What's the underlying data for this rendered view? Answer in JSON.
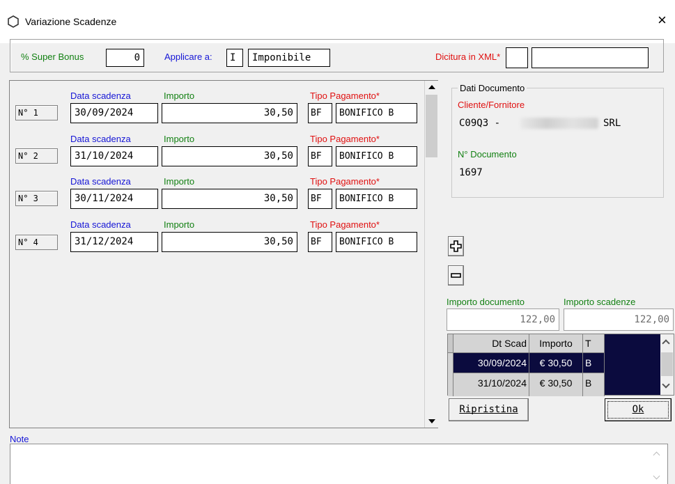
{
  "window": {
    "title": "Variazione Scadenze",
    "close": "×"
  },
  "top": {
    "super_bonus_label": "% Super Bonus",
    "super_bonus_value": "0",
    "applicare_label": "Applicare a:",
    "applicare_code": "I",
    "applicare_desc": "Imponibile",
    "dicitura_label": "Dicitura in XML*",
    "dicitura_code": "",
    "dicitura_desc": ""
  },
  "rows": [
    {
      "num": "N° 1",
      "date_label": "Data scadenza",
      "date": "30/09/2024",
      "amount_label": "Importo",
      "amount": "30,50",
      "pay_label": "Tipo Pagamento*",
      "pay_code": "BF",
      "pay_desc": "BONIFICO B"
    },
    {
      "num": "N° 2",
      "date_label": "Data scadenza",
      "date": "31/10/2024",
      "amount_label": "Importo",
      "amount": "30,50",
      "pay_label": "Tipo Pagamento*",
      "pay_code": "BF",
      "pay_desc": "BONIFICO B"
    },
    {
      "num": "N° 3",
      "date_label": "Data scadenza",
      "date": "30/11/2024",
      "amount_label": "Importo",
      "amount": "30,50",
      "pay_label": "Tipo Pagamento*",
      "pay_code": "BF",
      "pay_desc": "BONIFICO B"
    },
    {
      "num": "N° 4",
      "date_label": "Data scadenza",
      "date": "31/12/2024",
      "amount_label": "Importo",
      "amount": "30,50",
      "pay_label": "Tipo Pagamento*",
      "pay_code": "BF",
      "pay_desc": "BONIFICO B"
    }
  ],
  "dati": {
    "title": "Dati Documento",
    "cliente_label": "Cliente/Fornitore",
    "cliente_code": "C09Q3 -",
    "cliente_suffix": "SRL",
    "doc_label": "N° Documento",
    "doc_value": "1697"
  },
  "totals": {
    "doc_label": "Importo documento",
    "doc_value": "122,00",
    "scad_label": "Importo scadenze",
    "scad_value": "122,00"
  },
  "grid": {
    "headers": [
      "Dt Scad",
      "Importo",
      "T"
    ],
    "rows": [
      [
        "30/09/2024",
        "€ 30,50",
        "B"
      ],
      [
        "31/10/2024",
        "€ 30,50",
        "B"
      ]
    ]
  },
  "buttons": {
    "ripristina": "Ripristina",
    "ok": "Ok"
  },
  "note": {
    "label": "Note",
    "value": ""
  }
}
